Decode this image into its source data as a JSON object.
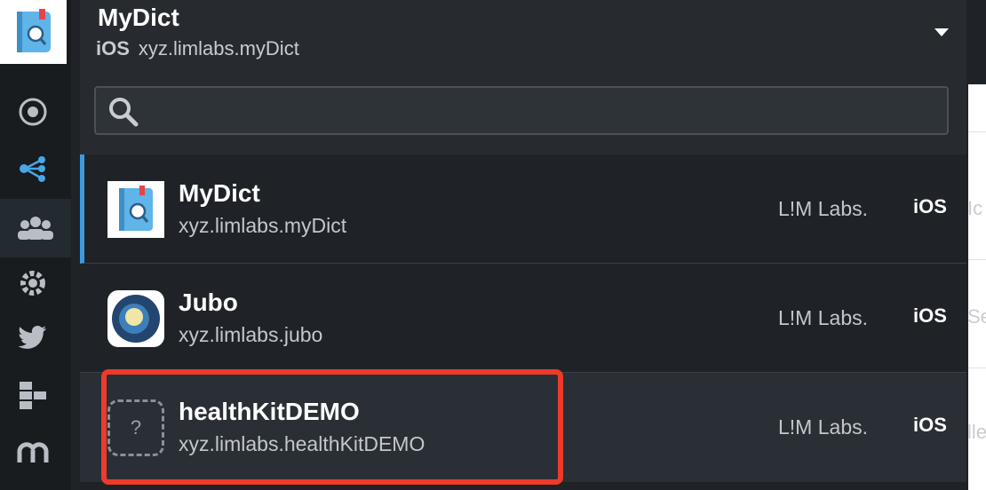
{
  "header": {
    "title": "MyDict",
    "platform": "iOS",
    "bundle": "xyz.limlabs.myDict"
  },
  "search": {
    "placeholder": "",
    "value": ""
  },
  "apps": [
    {
      "name": "MyDict",
      "bundle": "xyz.limlabs.myDict",
      "vendor": "L!M Labs.",
      "os": "iOS",
      "icon": "mydict-book-icon"
    },
    {
      "name": "Jubo",
      "bundle": "xyz.limlabs.jubo",
      "vendor": "L!M Labs.",
      "os": "iOS",
      "icon": "jubo-moon-icon"
    },
    {
      "name": "healthKitDEMO",
      "bundle": "xyz.limlabs.healthKitDEMO",
      "vendor": "L!M Labs.",
      "os": "iOS",
      "icon": "placeholder-question-icon",
      "placeholder_glyph": "?"
    }
  ],
  "sidebar": {
    "items": [
      "dashboard-icon",
      "share-network-icon",
      "users-icon",
      "gear-cog-icon",
      "twitter-icon",
      "blocks-icon",
      "m-logo-icon"
    ]
  },
  "background_text": {
    "row1": "Ic",
    "row2": "Se",
    "row3": "lle"
  },
  "colors": {
    "accent": "#3d9ae0",
    "highlight": "#ee3a2a",
    "panel": "#272b30",
    "list": "#1f2327"
  }
}
